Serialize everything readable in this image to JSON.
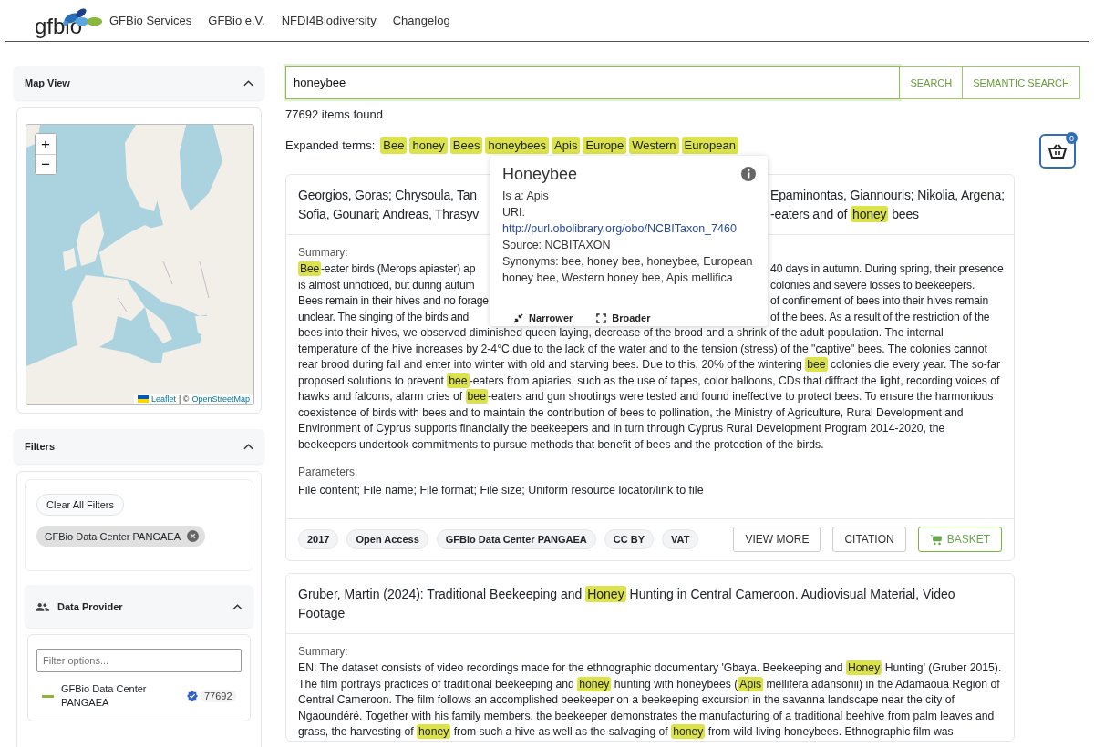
{
  "header": {
    "logo": "gfbio",
    "nav": [
      "GFBio Services",
      "GFBio e.V.",
      "NFDI4Biodiversity",
      "Changelog"
    ]
  },
  "sidebar": {
    "map_panel": {
      "title": "Map View",
      "expanded": true,
      "zoom_in": "+",
      "zoom_out": "−",
      "attribution": {
        "leaflet": "Leaflet",
        "separator": "| ©",
        "osm": "OpenStreetMap"
      }
    },
    "filters_panel": {
      "title": "Filters",
      "expanded": true,
      "clear_button": "Clear All Filters",
      "active_filters": [
        {
          "label": "GFBio Data Center PANGAEA"
        }
      ],
      "data_provider": {
        "title": "Data Provider",
        "expanded": true,
        "placeholder": "Filter options...",
        "options": [
          {
            "label": "GFBio Data Center PANGAEA",
            "count": "77692"
          }
        ]
      }
    }
  },
  "search": {
    "value": "honeybee",
    "buttons": [
      "SEARCH",
      "SEMANTIC SEARCH"
    ]
  },
  "results_count": "77692 items found",
  "expanded_terms": {
    "label": "Expanded terms:",
    "terms": [
      "Bee",
      "honey",
      "Bees",
      "honeybees",
      "Apis",
      "Europe",
      "Western",
      "European"
    ]
  },
  "basket": {
    "count": "0"
  },
  "tooltip": {
    "title": "Honeybee",
    "is_a": "Is a: Apis",
    "uri_label": "URI:",
    "uri": "http://purl.obolibrary.org/obo/NCBITaxon_7460",
    "source": "Source: NCBITAXON",
    "synonyms": "Synonyms: bee, honey bee, honeybee, European honey bee, Western honey bee, Apis mellifica",
    "buttons": [
      {
        "label": "Narrower",
        "kind": "narrower"
      },
      {
        "label": "Broader",
        "kind": "broader"
      }
    ]
  },
  "results": [
    {
      "title_lines": [
        {
          "left": [
            {
              "text": "Georgios, Goras; Chrysoula, Tan",
              "highlight": false
            }
          ],
          "right": [
            {
              "text": "Epaminontas, Giannouris; Nikolia, Argena;",
              "highlight": false
            }
          ]
        },
        {
          "left": [
            {
              "text": "Sofia, Gounari; Andreas, Thrasyv",
              "highlight": false
            }
          ],
          "right": [
            {
              "text": "-eaters and of ",
              "highlight": false
            },
            {
              "text": "honey",
              "highlight": true
            },
            {
              "text": " bees",
              "highlight": false
            }
          ]
        }
      ],
      "summary_label": "Summary:",
      "summary_lines": [
        {
          "left": [
            {
              "text": "Bee",
              "highlight": true
            },
            {
              "text": "-eater birds (Merops apiaster) ap",
              "highlight": false
            }
          ],
          "right": [
            {
              "text": "40 days in autumn. During spring, their presence",
              "highlight": false
            }
          ]
        },
        {
          "left": [
            {
              "text": "is almost unnoticed, but during autum",
              "highlight": false
            }
          ],
          "right": [
            {
              "text": "colonies and severe losses to beekeepers.",
              "highlight": false
            }
          ]
        },
        {
          "left": [
            {
              "text": "Bees remain in their hives and no forage",
              "highlight": false
            }
          ],
          "right": [
            {
              "text": "of confinement of bees into their hives remain",
              "highlight": false
            }
          ]
        },
        {
          "left": [
            {
              "text": "unclear. The singing of the birds and",
              "highlight": false
            }
          ],
          "right": [
            {
              "text": "of the bees. As a result of the restriction of the",
              "highlight": false
            }
          ]
        }
      ],
      "summary": [
        {
          "text": "bees into their hives, we observed diminished queen laying, decrease of the brood and a shrink of the adult population. The internal temperature of the hive increases by 2-4°C due to the lack of the water and to the tension (stress) of the \"captive\" bees. The colonies cannot rear brood during fall and enter into winter with old and starving bees. Due to this, 20% of the wintering ",
          "highlight": false
        },
        {
          "text": "bee",
          "highlight": true
        },
        {
          "text": " colonies die every year. The so-far proposed solutions to prevent ",
          "highlight": false
        },
        {
          "text": "bee",
          "highlight": true
        },
        {
          "text": "-eaters from apiaries, such as the use of tapes, color balloons, CDs that diffract the light, recording voices of hawks and falcons, alarm cries of ",
          "highlight": false
        },
        {
          "text": "bee",
          "highlight": true
        },
        {
          "text": "-eaters and gun shootings were tested and found ineffective to protect bees. To ensure the harmonious coexistence of birds with bees and to maintain the contribution of bees to pollination, the Ministry of Agriculture, Rural Development and Environment of Cyprus supports financially the beekeepers and in turn through Cyprus Rural Development Program 2014-2020, the beekeepers undertook commitments to pursue methods that benefit of bees and the protection of the birds.",
          "highlight": false
        }
      ],
      "parameters_label": "Parameters:",
      "parameters": "File content; File name; File format; File size; Uniform resource locator/link to file",
      "tags": [
        "2017",
        "Open Access",
        "GFBio Data Center PANGAEA",
        "CC BY",
        "VAT"
      ],
      "actions": [
        {
          "label": "VIEW MORE",
          "kind": "plain"
        },
        {
          "label": "CITATION",
          "kind": "plain"
        },
        {
          "label": "BASKET",
          "kind": "basket"
        }
      ]
    },
    {
      "title": [
        {
          "text": "Gruber, Martin (2024): Traditional Beekeeping and ",
          "highlight": false
        },
        {
          "text": "Honey",
          "highlight": true
        },
        {
          "text": " Hunting in Central Cameroon. Audiovisual Material, Video Footage",
          "highlight": false
        }
      ],
      "summary_label": "Summary:",
      "summary": [
        {
          "text": "EN: The dataset consists of video recordings made for the ethnographic documentary 'Gbaya. Beekeeping and ",
          "highlight": false
        },
        {
          "text": "Honey",
          "highlight": true
        },
        {
          "text": " Hunting' (Gruber 2015). The film portrays practices of traditional beekeeping and ",
          "highlight": false
        },
        {
          "text": "honey",
          "highlight": true
        },
        {
          "text": " hunting with honeybees (",
          "highlight": false
        },
        {
          "text": "Apis",
          "highlight": true
        },
        {
          "text": " mellifera adansonii) in the Adamaoua Region of Central Cameroon. The film follows an accomplished beekeeper on a beekeeping excursion in the savanna landscape near the city of Ngaoundéré. Together with his family members, the beekeeper demonstrates the manufacturing of a traditional beehive from palm leaves and grass, the harvesting of ",
          "highlight": false
        },
        {
          "text": "honey",
          "highlight": true
        },
        {
          "text": " from such a hive as well as the salvaging of ",
          "highlight": false
        },
        {
          "text": "honey",
          "highlight": true
        },
        {
          "text": " from wild living honeybees. Ethnographic film was",
          "highlight": false
        }
      ]
    }
  ]
}
